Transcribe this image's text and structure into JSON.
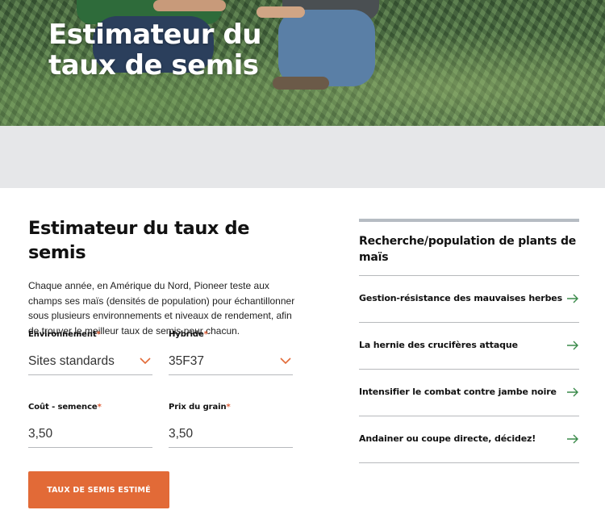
{
  "hero": {
    "title": "Estimateur du taux de semis"
  },
  "form": {
    "title": "Estimateur du taux de semis",
    "description": "Chaque année, en Amérique du Nord, Pioneer teste aux champs ses maïs (densités de population) pour échantillonner sous plusieurs environnements et niveaux de rendement, afin de trouver le meilleur taux de semis pour chacun.",
    "required_marker": "*",
    "environment": {
      "label": "Environnement",
      "value": "Sites standards"
    },
    "hybrid": {
      "label": "Hybride",
      "value": "35F37"
    },
    "seed_cost": {
      "label": "Coût - semence",
      "value": "3,50"
    },
    "grain_price": {
      "label": "Prix du grain",
      "value": "3,50"
    },
    "submit_label": "TAUX DE SEMIS ESTIMÉ"
  },
  "sidebar": {
    "title": "Recherche/population de plants de maïs",
    "items": [
      {
        "label": "Gestion-résistance des mauvaises herbes"
      },
      {
        "label": "La hernie des crucifères attaque"
      },
      {
        "label": "Intensifier le combat contre jambe noire"
      },
      {
        "label": "Andainer ou coupe directe, décidez!"
      }
    ]
  },
  "colors": {
    "accent": "#e26a37",
    "arrow": "#3a8a4a",
    "band": "#e6e7e9"
  }
}
